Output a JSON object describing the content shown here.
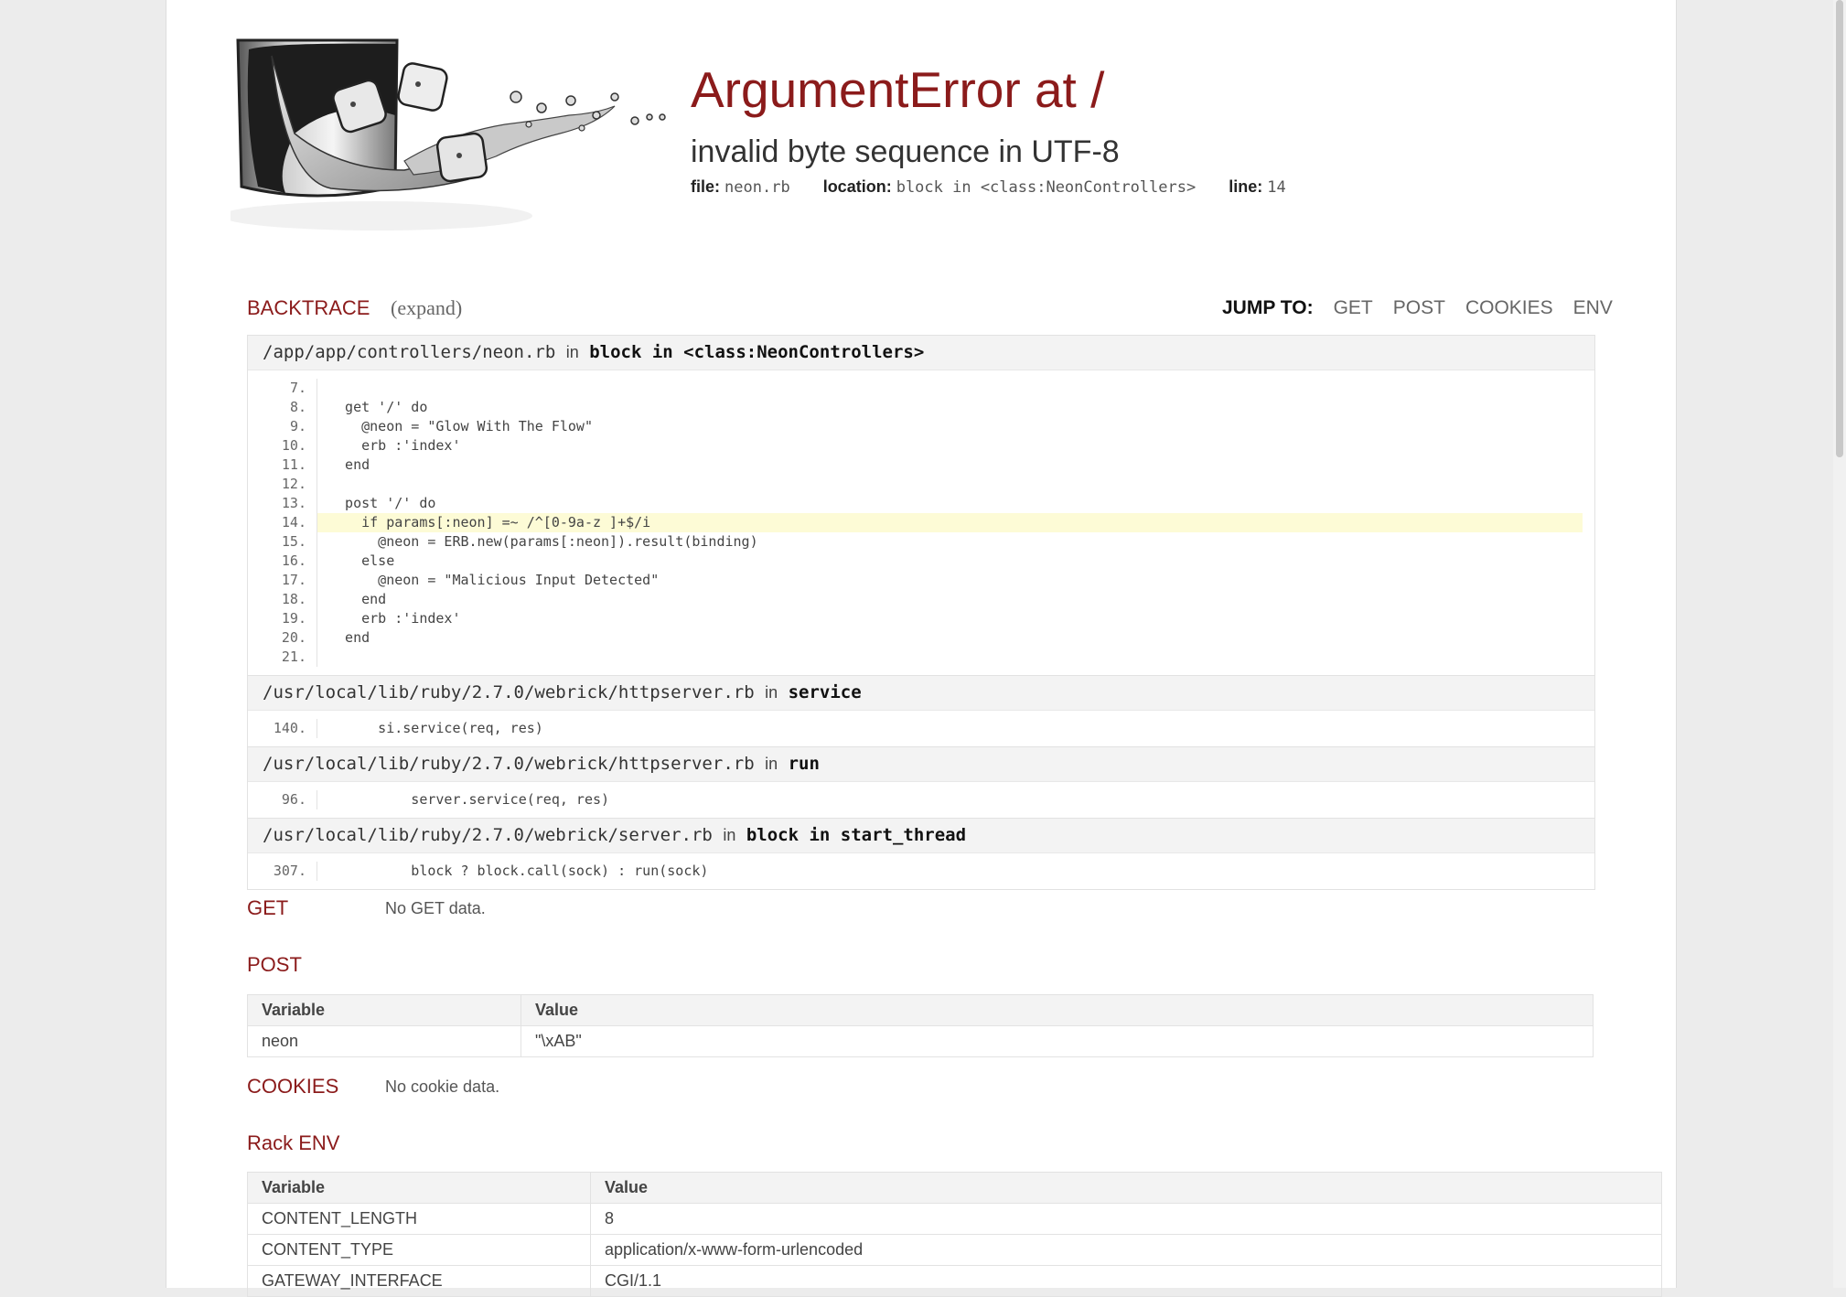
{
  "header": {
    "title": "ArgumentError at /",
    "subtitle": "invalid byte sequence in UTF-8",
    "file_label": "file:",
    "file_value": "neon.rb",
    "location_label": "location:",
    "location_value": "block in <class:NeonControllers>",
    "line_label": "line:",
    "line_value": "14"
  },
  "backtrace": {
    "title": "BACKTRACE",
    "expand": "(expand)",
    "in_word": "in",
    "frames": [
      {
        "path": "/app/app/controllers/neon.rb",
        "fn": "block in <class:NeonControllers>",
        "lines": [
          {
            "n": "7.",
            "code": ""
          },
          {
            "n": "8.",
            "code": "  get '/' do"
          },
          {
            "n": "9.",
            "code": "    @neon = \"Glow With The Flow\""
          },
          {
            "n": "10.",
            "code": "    erb :'index'"
          },
          {
            "n": "11.",
            "code": "  end"
          },
          {
            "n": "12.",
            "code": ""
          },
          {
            "n": "13.",
            "code": "  post '/' do"
          },
          {
            "n": "14.",
            "code": "    if params[:neon] =~ /^[0-9a-z ]+$/i",
            "hl": true
          },
          {
            "n": "15.",
            "code": "      @neon = ERB.new(params[:neon]).result(binding)"
          },
          {
            "n": "16.",
            "code": "    else"
          },
          {
            "n": "17.",
            "code": "      @neon = \"Malicious Input Detected\""
          },
          {
            "n": "18.",
            "code": "    end"
          },
          {
            "n": "19.",
            "code": "    erb :'index'"
          },
          {
            "n": "20.",
            "code": "  end"
          },
          {
            "n": "21.",
            "code": ""
          }
        ]
      },
      {
        "path": "/usr/local/lib/ruby/2.7.0/webrick/httpserver.rb",
        "fn": "service",
        "lines": [
          {
            "n": "140.",
            "code": "      si.service(req, res)"
          }
        ]
      },
      {
        "path": "/usr/local/lib/ruby/2.7.0/webrick/httpserver.rb",
        "fn": "run",
        "lines": [
          {
            "n": "96.",
            "code": "          server.service(req, res)"
          }
        ]
      },
      {
        "path": "/usr/local/lib/ruby/2.7.0/webrick/server.rb",
        "fn": "block in start_thread",
        "lines": [
          {
            "n": "307.",
            "code": "          block ? block.call(sock) : run(sock)"
          }
        ]
      }
    ]
  },
  "jump": {
    "label": "JUMP TO:",
    "links": [
      "GET",
      "POST",
      "COOKIES",
      "ENV"
    ]
  },
  "get": {
    "title": "GET",
    "empty": "No GET data."
  },
  "post": {
    "title": "POST",
    "col_variable": "Variable",
    "col_value": "Value",
    "rows": [
      {
        "variable": "neon",
        "value": "\"\\xAB\""
      }
    ]
  },
  "cookies": {
    "title": "COOKIES",
    "empty": "No cookie data."
  },
  "env": {
    "title": "Rack ENV",
    "col_variable": "Variable",
    "col_value": "Value",
    "rows": [
      {
        "variable": "CONTENT_LENGTH",
        "value": "8"
      },
      {
        "variable": "CONTENT_TYPE",
        "value": "application/x-www-form-urlencoded"
      },
      {
        "variable": "GATEWAY_INTERFACE",
        "value": "CGI/1.1"
      }
    ]
  },
  "colors": {
    "accent": "#8b1b1b",
    "highlight": "#fdfbd6",
    "header_bg": "#f3f3f3"
  },
  "logo_icon": "sinatra-glass-dice-logo"
}
